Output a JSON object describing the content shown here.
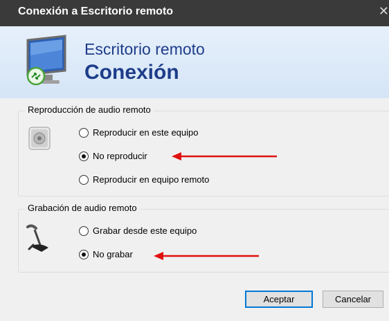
{
  "window": {
    "title": "Conexión a Escritorio remoto",
    "close_glyph": "✕"
  },
  "banner": {
    "line1": "Escritorio remoto",
    "line2": "Conexión",
    "icon": "remote-desktop-monitor-icon"
  },
  "playback": {
    "legend": "Reproducción de audio remoto",
    "icon": "speaker-icon",
    "options": [
      {
        "label": "Reproducir en este equipo",
        "checked": false
      },
      {
        "label": "No reproducir",
        "checked": true
      },
      {
        "label": "Reproducir en equipo remoto",
        "checked": false
      }
    ]
  },
  "recording": {
    "legend": "Grabación de audio remoto",
    "icon": "microphone-icon",
    "options": [
      {
        "label": "Grabar desde este equipo",
        "checked": false
      },
      {
        "label": "No grabar",
        "checked": true
      }
    ]
  },
  "buttons": {
    "accept": "Aceptar",
    "cancel": "Cancelar"
  },
  "colors": {
    "titlebar": "#3a3a3a",
    "banner_text": "#1d3d8a",
    "annotation_arrow": "#e01010",
    "primary_border": "#0078d7"
  }
}
